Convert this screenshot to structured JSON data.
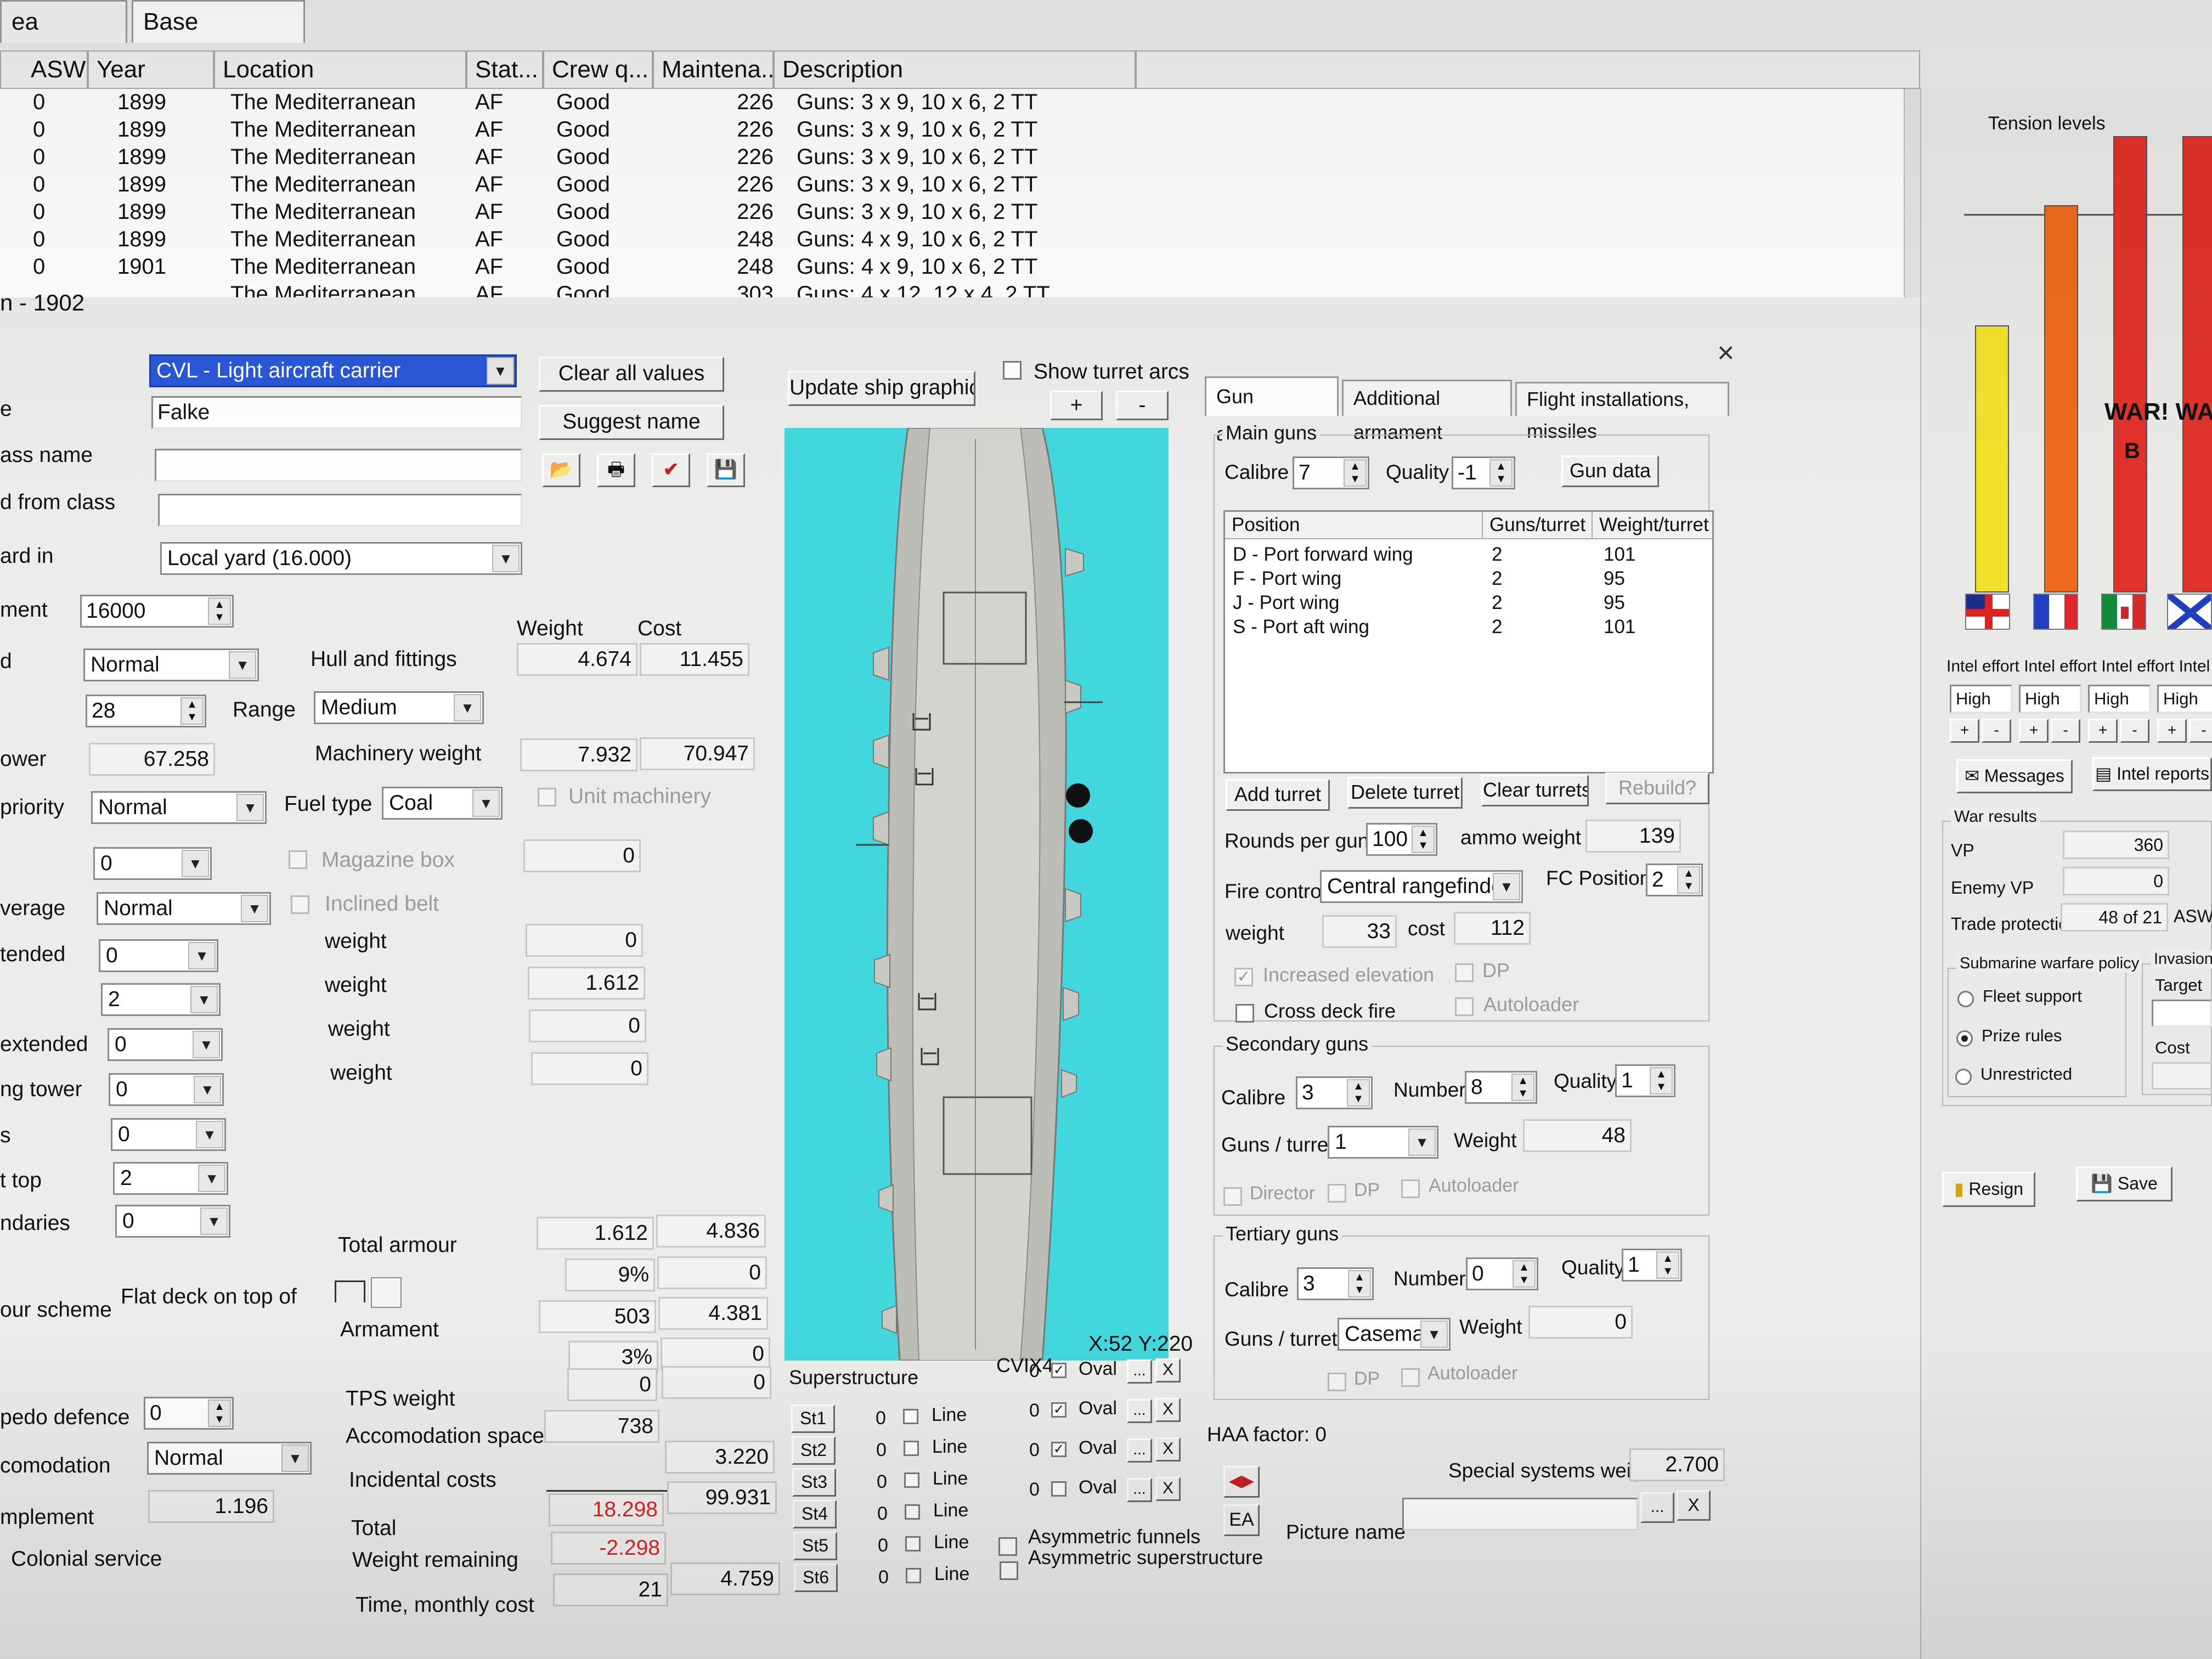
{
  "tabs": [
    "ea overview",
    "Base overview"
  ],
  "ship_table": {
    "columns": [
      "ASW",
      "Year",
      "Location",
      "Stat...",
      "Crew q...",
      "Maintena...",
      "Description"
    ],
    "rows": [
      [
        "0",
        "1899",
        "The Mediterranean",
        "AF",
        "Good",
        "226",
        "Guns: 3 x 9, 10 x 6, 2 TT"
      ],
      [
        "0",
        "1899",
        "The Mediterranean",
        "AF",
        "Good",
        "226",
        "Guns: 3 x 9, 10 x 6, 2 TT"
      ],
      [
        "0",
        "1899",
        "The Mediterranean",
        "AF",
        "Good",
        "226",
        "Guns: 3 x 9, 10 x 6, 2 TT"
      ],
      [
        "0",
        "1899",
        "The Mediterranean",
        "AF",
        "Good",
        "226",
        "Guns: 3 x 9, 10 x 6, 2 TT"
      ],
      [
        "0",
        "1899",
        "The Mediterranean",
        "AF",
        "Good",
        "226",
        "Guns: 3 x 9, 10 x 6, 2 TT"
      ],
      [
        "0",
        "1899",
        "The Mediterranean",
        "AF",
        "Good",
        "248",
        "Guns: 4 x 9, 10 x 6, 2 TT"
      ],
      [
        "0",
        "1901",
        "The Mediterranean",
        "AF",
        "Good",
        "248",
        "Guns: 4 x 9, 10 x 6, 2 TT"
      ],
      [
        "",
        "",
        "The Mediterranean",
        "AF",
        "Good",
        "303",
        "Guns: 4 x 12, 12 x 4, 2 TT"
      ]
    ]
  },
  "designer": {
    "year_title": "n - 1902",
    "ship_type": "CVL - Light aircraft carrier",
    "name_label": "e",
    "name_value": "Falke",
    "class_name_label": "ass name",
    "from_class_label": "d from class",
    "yard_label": "ard in",
    "yard_value": "Local yard (16.000)",
    "displacement_label": "ment",
    "displacement_value": "16000",
    "d_label": "d",
    "d_value": "Normal",
    "speed_value": "28",
    "range_label": "Range",
    "range_value": "Medium",
    "power_label": "ower",
    "power_value": "67.258",
    "priority_label": "priority",
    "priority_value": "Normal",
    "fuel_label": "Fuel type",
    "fuel_value": "Coal",
    "unit_machinery": "Unit machinery",
    "field0_value": "0",
    "magazine_box": "Magazine box",
    "coverage_label": "verage",
    "coverage_value": "Normal",
    "inclined_belt": "Inclined belt",
    "extended_label": "tended",
    "extended_value": "0",
    "field_two": "2",
    "extended2_label": "extended",
    "extended2_value": "0",
    "tower_label": "ng tower",
    "tower_value": "0",
    "s_label": "s",
    "s_value": "0",
    "top_label": "t top",
    "top_value": "2",
    "boundaries_label": "ndaries",
    "boundaries_value": "0",
    "scheme_label": "our scheme",
    "scheme_value": "Flat deck on top of",
    "torpedo_label": "pedo defence",
    "torpedo_value": "0",
    "accom_label": "comodation",
    "accom_value": "Normal",
    "complement_label": "mplement",
    "complement_value": "1.196",
    "colonial": "Colonial service",
    "clear_all": "Clear all values",
    "suggest_name": "Suggest name",
    "update_graphic": "Update ship graphic",
    "show_turret_arcs": "Show turret arcs",
    "plus": "+",
    "minus": "-"
  },
  "weights": {
    "weight_hdr": "Weight",
    "cost_hdr": "Cost",
    "hull_label": "Hull and fittings",
    "hull_weight": "4.674",
    "hull_cost": "11.455",
    "mach_label": "Machinery weight",
    "mach_weight": "7.932",
    "mach_cost": "70.947",
    "w0": "0",
    "w_label": "weight",
    "w1": "0",
    "w2": "1.612",
    "w3": "0",
    "w4": "0",
    "total_armour_label": "Total armour",
    "total_armour_w": "1.612",
    "total_armour_c": "4.836",
    "armour_pct": "9%",
    "armour_pct_c": "0",
    "armament_label": "Armament",
    "armament_w": "503",
    "armament_c": "4.381",
    "armament_pct": "3%",
    "armament_pct_c": "0",
    "tps_label": "TPS weight",
    "tps_w": "0",
    "tps_c": "0",
    "accom_label": "Accomodation space",
    "accom_w": "738",
    "incidental_label": "Incidental costs",
    "incidental_c": "3.220",
    "total_label": "Total",
    "total_w": "18.298",
    "total_c": "99.931",
    "remaining_label": "Weight remaining",
    "remaining_w": "-2.298",
    "time_label": "Time, monthly cost",
    "time_w": "21",
    "time_c": "4.759"
  },
  "graphic": {
    "coords": "X:52 Y:220",
    "superstructure_label": "Superstructure",
    "cv_label": "CVIX4",
    "rows": [
      {
        "name": "St1",
        "a": "0",
        "line": "Line",
        "b": "0",
        "oval": "Oval",
        "checked": true
      },
      {
        "name": "St2",
        "a": "0",
        "line": "Line",
        "b": "0",
        "oval": "Oval",
        "checked": true
      },
      {
        "name": "St3",
        "a": "0",
        "line": "Line",
        "b": "0",
        "oval": "Oval",
        "checked": true
      },
      {
        "name": "St4",
        "a": "0",
        "line": "Line",
        "b": "0",
        "oval": "Oval",
        "checked": false
      },
      {
        "name": "St5",
        "a": "0",
        "line": "Line"
      },
      {
        "name": "St6",
        "a": "0",
        "line": "Line"
      }
    ],
    "dots": "...",
    "x": "X",
    "asym_funnels": "Asymmetric funnels",
    "asym_super": "Asymmetric superstructure"
  },
  "guns": {
    "tabs": [
      "Gun armament",
      "Additional armament",
      "Flight installations, missiles"
    ],
    "main_title": "Main guns",
    "calibre_label": "Calibre",
    "calibre_value": "7",
    "quality_label": "Quality",
    "quality_value": "-1",
    "gun_data": "Gun data",
    "list_headers": [
      "Position",
      "Guns/turret",
      "Weight/turret"
    ],
    "list_rows": [
      [
        "D - Port forward wing",
        "2",
        "101"
      ],
      [
        "F - Port wing",
        "2",
        "95"
      ],
      [
        "J - Port wing",
        "2",
        "95"
      ],
      [
        "S - Port aft wing",
        "2",
        "101"
      ]
    ],
    "add_turret": "Add turret",
    "delete_turret": "Delete turret",
    "clear_turrets": "Clear turrets",
    "rebuild": "Rebuild?",
    "rounds_label": "Rounds per gun",
    "rounds_value": "100",
    "ammo_label": "ammo weight",
    "ammo_value": "139",
    "fire_control_label": "Fire control",
    "fire_control_value": "Central rangefinder",
    "fc_positions_label": "FC Positions",
    "fc_positions_value": "2",
    "fc_weight_label": "weight",
    "fc_weight_value": "33",
    "fc_cost_label": "cost",
    "fc_cost_value": "112",
    "increased_elevation": "Increased elevation",
    "dp": "DP",
    "cross_deck": "Cross deck fire",
    "autoloader": "Autoloader",
    "secondary_title": "Secondary guns",
    "sec_calibre": "3",
    "number_label": "Number",
    "sec_number": "8",
    "sec_quality": "1",
    "guns_turret_label": "Guns / turret",
    "sec_guns_turret": "1",
    "weight_label": "Weight",
    "sec_weight": "48",
    "director": "Director",
    "tertiary_title": "Tertiary guns",
    "ter_calibre": "3",
    "ter_number": "0",
    "ter_quality": "1",
    "ter_guns_turret": "Casemate",
    "ter_weight": "0",
    "haa_factor": "HAA factor: 0",
    "special_label": "Special systems weight",
    "special_value": "2.700",
    "picture_label": "Picture name",
    "ea": "EA",
    "close": "×"
  },
  "sidebar": {
    "tension_title": "Tension levels",
    "war_text": "WAR! WAI",
    "war_sub": "B",
    "bars": [
      {
        "color": "#f0e22a",
        "level": 0.58
      },
      {
        "color": "#ef6a1c",
        "level": 0.84
      },
      {
        "color": "#e0322a",
        "level": 0.99
      },
      {
        "color": "#e0322a",
        "level": 0.99
      }
    ],
    "intel_effort_label": "Intel effort Intel effort Intel effort Intel effo",
    "intel_values": [
      "High",
      "High",
      "High",
      "High"
    ],
    "messages": "Messages",
    "intel_reports": "Intel reports",
    "war_results_title": "War results",
    "vp_label": "VP",
    "vp_value": "360",
    "enemy_vp_label": "Enemy VP",
    "enemy_vp_value": "0",
    "trade_label": "Trade protection",
    "trade_value": "48 of 21",
    "asw": "ASW",
    "sub_policy_title": "Submarine warfare policy",
    "fleet_support": "Fleet support",
    "prize_rules": "Prize rules",
    "unrestricted": "Unrestricted",
    "invasion_title": "Invasion",
    "target_label": "Target",
    "cost_label": "Cost",
    "resign": "Resign",
    "save": "Save"
  }
}
